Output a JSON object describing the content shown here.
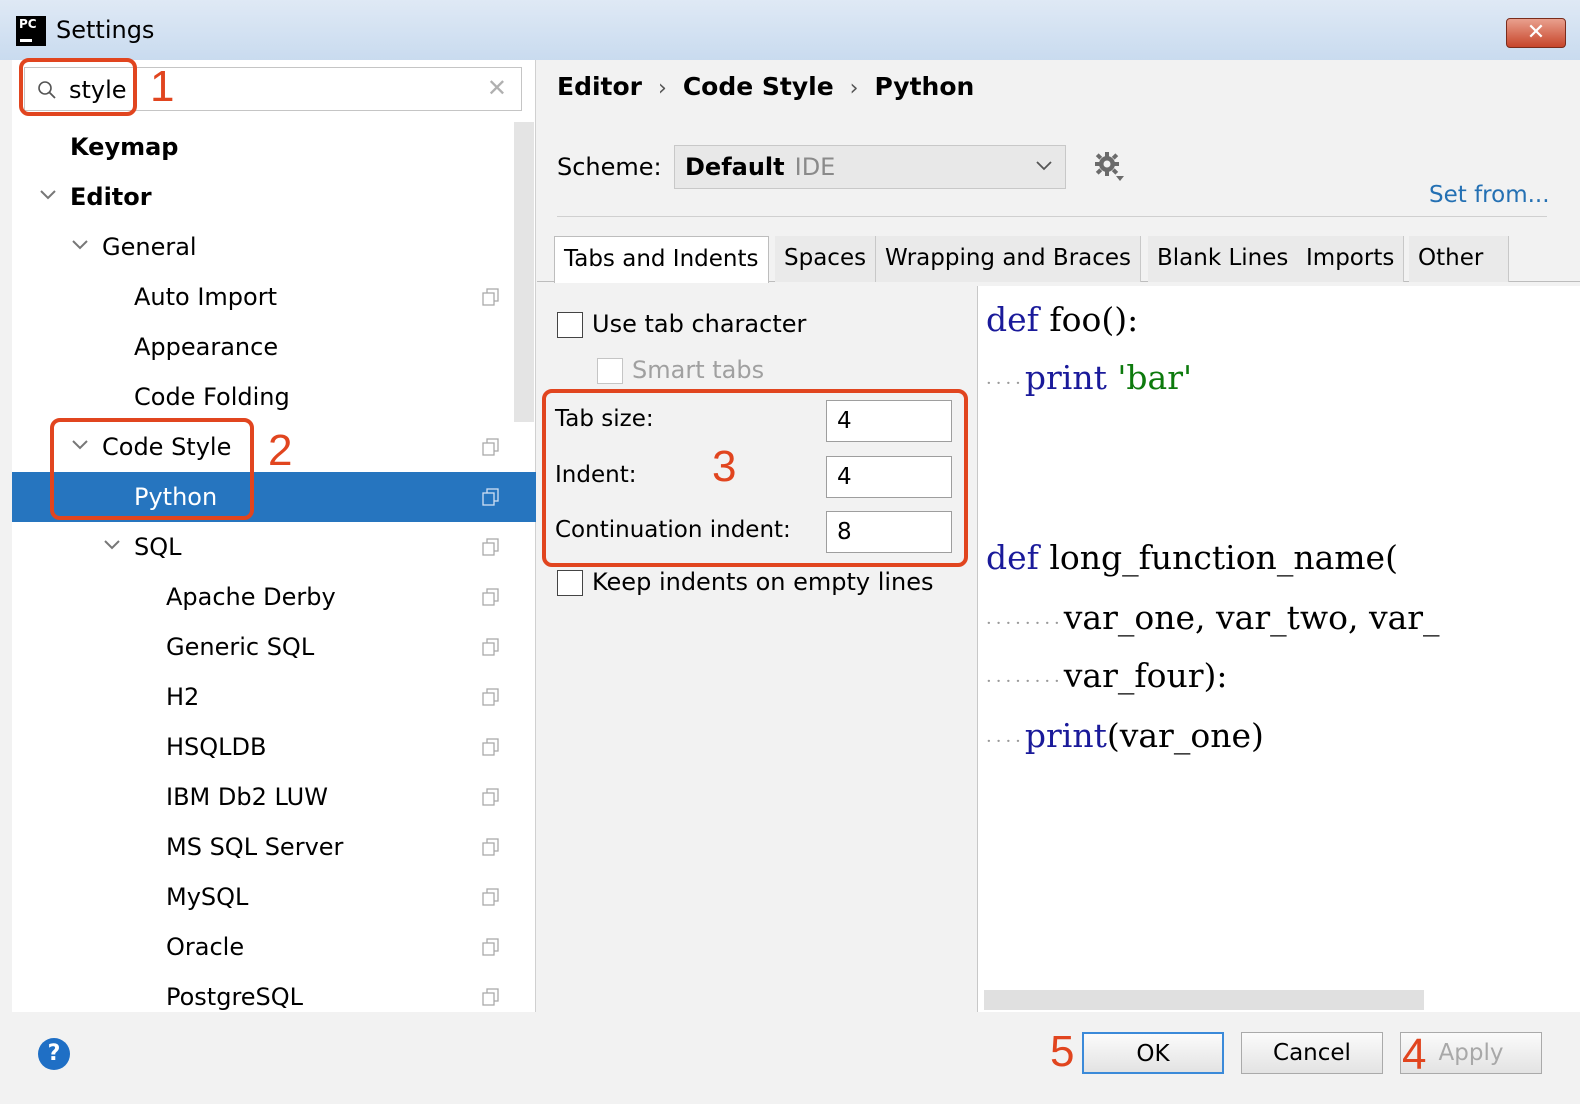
{
  "window": {
    "title": "Settings",
    "app_icon": "PC",
    "close_icon": "close-icon"
  },
  "search": {
    "value": "style",
    "icon": "search-icon",
    "clear_icon": "clear-icon"
  },
  "tree": {
    "items": [
      {
        "label": "Keymap"
      },
      {
        "label": "Editor"
      },
      {
        "label": "General"
      },
      {
        "label": "Auto Import"
      },
      {
        "label": "Appearance"
      },
      {
        "label": "Code Folding"
      },
      {
        "label": "Code Style"
      },
      {
        "label": "Python"
      },
      {
        "label": "SQL"
      },
      {
        "label": "Apache Derby"
      },
      {
        "label": "Generic SQL"
      },
      {
        "label": "H2"
      },
      {
        "label": "HSQLDB"
      },
      {
        "label": "IBM Db2 LUW"
      },
      {
        "label": "MS SQL Server"
      },
      {
        "label": "MySQL"
      },
      {
        "label": "Oracle"
      },
      {
        "label": "PostgreSQL"
      }
    ],
    "selected": "Python"
  },
  "breadcrumb": {
    "a": "Editor",
    "b": "Code Style",
    "c": "Python",
    "sep": "›"
  },
  "scheme": {
    "label": "Scheme:",
    "name": "Default",
    "sub": "IDE",
    "set_from": "Set from..."
  },
  "tabs": [
    "Tabs and Indents",
    "Spaces",
    "Wrapping and Braces",
    "Blank Lines",
    "Imports",
    "Other"
  ],
  "settings": {
    "use_tab": "Use tab character",
    "smart_tabs": "Smart tabs",
    "tab_size_label": "Tab size:",
    "tab_size": "4",
    "indent_label": "Indent:",
    "indent": "4",
    "cont_label": "Continuation indent:",
    "cont": "8",
    "keep_indents": "Keep indents on empty lines"
  },
  "preview": {
    "l1_kw": "def",
    "l1_rest": "foo():",
    "l2_kw": "print",
    "l2_str": "'bar'",
    "l3_kw": "def",
    "l3_rest": "long_function_name(",
    "l4": "var_one, var_two, var_",
    "l5": "var_four):",
    "l6_kw": "print",
    "l6_rest": "(var_one)",
    "ws4": "····",
    "ws8": "········"
  },
  "buttons": {
    "help": "?",
    "ok": "OK",
    "cancel": "Cancel",
    "apply": "Apply"
  },
  "annotations": [
    "1",
    "2",
    "3",
    "4",
    "5"
  ],
  "colors": {
    "accent": "#2675bf",
    "annotation": "#e1451f",
    "keyword": "#1a1a9a",
    "string": "#0d7a0d"
  }
}
